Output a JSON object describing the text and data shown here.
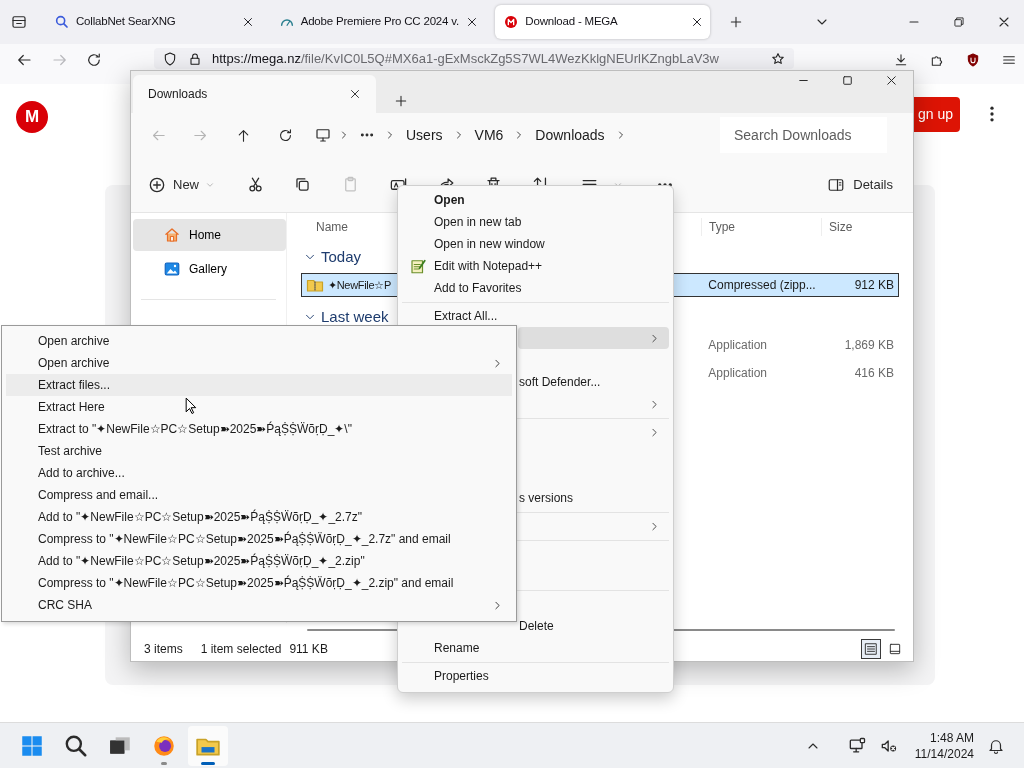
{
  "browser": {
    "tabs": [
      {
        "kind": "search",
        "title": "CollabNet SearXNG",
        "selected": false
      },
      {
        "kind": "gauge",
        "title": "Adobe Premiere Pro CC 2024 v.",
        "selected": false
      },
      {
        "kind": "logo",
        "title": "Download - MEGA",
        "selected": true
      }
    ],
    "forward_disabled": true,
    "url_host": "https://mega.nz",
    "url_path": "/file/KvIC0L5Q#MX6a1-gExMsckZg5S7WL4WezKklgNEUrlKZngbLaV3w"
  },
  "page": {
    "logo_letter": "M",
    "signup_label": "gn up"
  },
  "explorer": {
    "tab_title": "Downloads",
    "nav": [
      {
        "kind": "back",
        "disabled": true
      },
      {
        "kind": "forward",
        "disabled": true
      },
      {
        "kind": "up",
        "disabled": false
      },
      {
        "kind": "refresh",
        "disabled": false
      }
    ],
    "breadcrumb": [
      "Users",
      "VM6",
      "Downloads"
    ],
    "search_placeholder": "Search Downloads",
    "new_label": "New",
    "toolbar": [
      {
        "kind": "cut",
        "disabled": false
      },
      {
        "kind": "copy",
        "disabled": false
      },
      {
        "kind": "paste",
        "disabled": true
      },
      {
        "kind": "rename",
        "disabled": false
      },
      {
        "kind": "share",
        "disabled": false
      },
      {
        "kind": "delete",
        "disabled": false
      },
      {
        "kind": "sort",
        "disabled": false
      },
      {
        "kind": "view",
        "disabled": false
      }
    ],
    "details_label": "Details",
    "sidebar": [
      {
        "kind": "home",
        "label": "Home",
        "selected": true
      },
      {
        "kind": "gallery",
        "label": "Gallery",
        "selected": false
      }
    ],
    "columns": [
      "Name",
      "Type",
      "Size"
    ],
    "groups": [
      {
        "label": "Today",
        "files": [
          {
            "kind": "zip",
            "name": "✦NewFile☆P",
            "type": "Compressed (zipp...",
            "size": "912 KB",
            "selected": true
          }
        ]
      },
      {
        "label": "Last week",
        "files": [
          {
            "kind": "app",
            "type": "Application",
            "size": "1,869 KB",
            "selected": false
          },
          {
            "kind": "app",
            "type": "Application",
            "size": "416 KB",
            "selected": false
          }
        ]
      }
    ],
    "status": {
      "count": "3 items",
      "selection": "1 item selected",
      "selection_size": "911 KB"
    },
    "views": [
      {
        "kind": "details",
        "selected": true
      },
      {
        "kind": "tiles",
        "selected": false
      }
    ]
  },
  "context_menu": [
    {
      "kind": "item",
      "label": "Open",
      "bold": true,
      "icon": false,
      "submenu": false,
      "selected": false
    },
    {
      "kind": "item",
      "label": "Open in new tab",
      "bold": false,
      "icon": false,
      "submenu": false,
      "selected": false
    },
    {
      "kind": "item",
      "label": "Open in new window",
      "bold": false,
      "icon": false,
      "submenu": false,
      "selected": false
    },
    {
      "kind": "item",
      "label": "Edit with Notepad++",
      "bold": false,
      "icon": true,
      "submenu": false,
      "selected": false
    },
    {
      "kind": "item",
      "label": "Add to Favorites",
      "bold": false,
      "icon": false,
      "submenu": false,
      "selected": false
    },
    {
      "kind": "separator"
    },
    {
      "kind": "item",
      "label": "Extract All...",
      "bold": false,
      "icon": false,
      "submenu": false,
      "selected": false
    },
    {
      "kind": "item",
      "submenu": true,
      "selected": true
    },
    {
      "kind": "item"
    },
    {
      "kind": "item",
      "label": "soft Defender...",
      "bold": false,
      "icon": false,
      "submenu": false,
      "selected": false
    },
    {
      "kind": "item",
      "submenu": true,
      "selected": false
    },
    {
      "kind": "separator"
    },
    {
      "kind": "item",
      "submenu": true,
      "selected": false
    },
    {
      "kind": "item"
    },
    {
      "kind": "item"
    },
    {
      "kind": "item",
      "label": "s versions",
      "bold": false,
      "icon": false,
      "submenu": false,
      "selected": false
    },
    {
      "kind": "separator"
    },
    {
      "kind": "item",
      "submenu": true,
      "selected": false
    },
    {
      "kind": "separator"
    },
    {
      "kind": "item"
    },
    {
      "kind": "item"
    },
    {
      "kind": "separator"
    },
    {
      "kind": "item"
    },
    {
      "kind": "item",
      "label": "Delete",
      "bold": false,
      "icon": false,
      "submenu": false,
      "selected": false
    },
    {
      "kind": "item",
      "label": "Rename",
      "bold": false,
      "icon": false,
      "submenu": false,
      "selected": false
    },
    {
      "kind": "separator"
    },
    {
      "kind": "item",
      "label": "Properties",
      "bold": false,
      "icon": false,
      "submenu": false,
      "selected": false
    }
  ],
  "archive_menu": [
    {
      "label": "Open archive",
      "submenu": false,
      "selected": false
    },
    {
      "label": "Open archive",
      "submenu": true,
      "selected": false
    },
    {
      "label": "Extract files...",
      "submenu": false,
      "selected": true
    },
    {
      "label": "Extract Here",
      "submenu": false,
      "selected": false
    },
    {
      "label": "Extract to \"✦NewFile☆PC☆Setup➽2025➽ṔąṨṨẄõṛḌ_✦\\\"",
      "submenu": false,
      "selected": false
    },
    {
      "label": "Test archive",
      "submenu": false,
      "selected": false
    },
    {
      "label": "Add to archive...",
      "submenu": false,
      "selected": false
    },
    {
      "label": "Compress and email...",
      "submenu": false,
      "selected": false
    },
    {
      "label": "Add to \"✦NewFile☆PC☆Setup➽2025➽ṔąṨṨẄõṛḌ_✦_2.7z\"",
      "submenu": false,
      "selected": false
    },
    {
      "label": "Compress to \"✦NewFile☆PC☆Setup➽2025➽ṔąṨṨẄõṛḌ_✦_2.7z\" and email",
      "submenu": false,
      "selected": false
    },
    {
      "label": "Add to \"✦NewFile☆PC☆Setup➽2025➽ṔąṨṨẄõṛḌ_✦_2.zip\"",
      "submenu": false,
      "selected": false
    },
    {
      "label": "Compress to \"✦NewFile☆PC☆Setup➽2025➽ṔąṨṨẄõṛḌ_✦_2.zip\" and email",
      "submenu": false,
      "selected": false
    },
    {
      "label": "CRC SHA",
      "submenu": true,
      "selected": false
    }
  ],
  "taskbar": {
    "apps": [
      {
        "kind": "start",
        "running": false,
        "active": false
      },
      {
        "kind": "search",
        "running": false,
        "active": false
      },
      {
        "kind": "task_view",
        "running": false,
        "active": false
      },
      {
        "kind": "browser",
        "running": true,
        "active": false
      },
      {
        "kind": "files",
        "running": true,
        "active": true
      }
    ],
    "time": "1:48 AM",
    "date": "11/14/2024"
  }
}
